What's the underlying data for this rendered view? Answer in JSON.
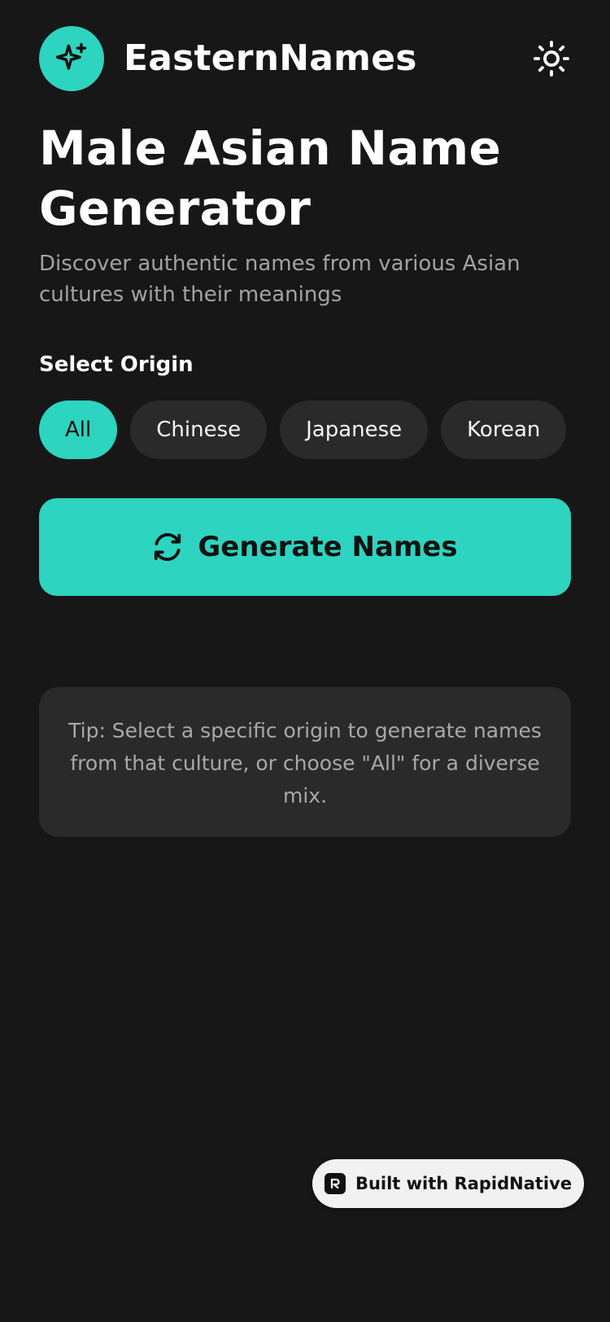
{
  "header": {
    "brand": "EasternNames",
    "logo_icon": "sparkle-icon",
    "theme_toggle_icon": "sun-icon"
  },
  "page": {
    "title": "Male Asian Name Generator",
    "subtitle": "Discover authentic names from various Asian cultures with their meanings"
  },
  "origin": {
    "label": "Select Origin",
    "selected": "All",
    "options": [
      {
        "label": "All"
      },
      {
        "label": "Chinese"
      },
      {
        "label": "Japanese"
      },
      {
        "label": "Korean"
      }
    ]
  },
  "generate": {
    "label": "Generate Names",
    "icon": "refresh-icon"
  },
  "tip": {
    "text": "Tip: Select a specific origin to generate names from that culture, or choose \"All\" for a diverse mix."
  },
  "badge": {
    "label": "Built with RapidNative",
    "icon": "rapidnative-logo-icon"
  },
  "colors": {
    "background": "#171717",
    "accent": "#2dd4bf",
    "surface": "#2a2a2a",
    "muted_text": "#a3a3a3"
  }
}
